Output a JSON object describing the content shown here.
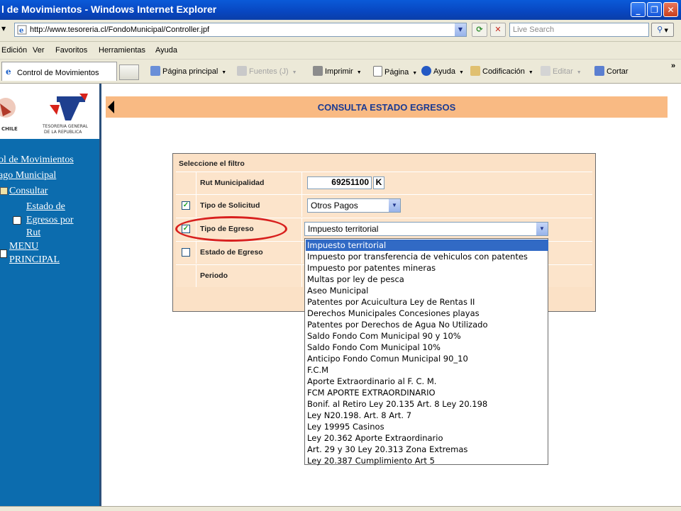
{
  "window": {
    "title": "l de Movimientos - Windows Internet Explorer",
    "controls": [
      "minimize",
      "maximize",
      "close"
    ]
  },
  "addressbar": {
    "url": "http://www.tesoreria.cl/FondoMunicipal/Controller.jpf",
    "search_placeholder": "Live Search"
  },
  "menubar": [
    "Edición",
    "Ver",
    "Favoritos",
    "Herramientas",
    "Ayuda"
  ],
  "tab": {
    "label": "Control de Movimientos"
  },
  "commandbar": {
    "home": "Página principal",
    "feeds": "Fuentes (J)",
    "print": "Imprimir",
    "page": "Página",
    "help": "Ayuda",
    "encoding": "Codificación",
    "edit": "Editar",
    "cut": "Cortar"
  },
  "logo": {
    "chile_text": "CHILE",
    "org_line1": "TESORERIA GENERAL",
    "org_line2": "DE LA REPUBLICA"
  },
  "sidebar": {
    "link1": "ol de Movimientos",
    "link2": "ago Municipal",
    "link3": "Consultar",
    "link4_l1": "Estado de",
    "link4_l2": "Egresos por",
    "link4_l3": "Rut",
    "link5_l1": "MENU",
    "link5_l2": "PRINCIPAL"
  },
  "header": {
    "title": "CONSULTA ESTADO EGRESOS"
  },
  "filter": {
    "title": "Seleccione el filtro",
    "rut_label": "Rut Municipalidad",
    "rut_value": "69251100",
    "rut_dv": "K",
    "tipo_solicitud_label": "Tipo de Solicitud",
    "tipo_solicitud_value": "Otros Pagos",
    "tipo_solicitud_checked": true,
    "tipo_egreso_label": "Tipo de Egreso",
    "tipo_egreso_value": "Impuesto territorial",
    "tipo_egreso_checked": true,
    "estado_egreso_label": "Estado de Egreso",
    "estado_egreso_checked": false,
    "periodo_label": "Periodo"
  },
  "egreso_options": [
    "Impuesto territorial",
    "Impuesto por transferencia de vehiculos con patentes",
    "Impuesto por patentes mineras",
    "Multas por ley de pesca",
    "Aseo Municipal",
    "Patentes por Acuicultura Ley de Rentas II",
    "Derechos Municipales Concesiones playas",
    "Patentes por Derechos de Agua No Utilizado",
    "Saldo Fondo Com Municipal 90 y 10%",
    "Saldo Fondo Com Municipal 10%",
    "Anticipo Fondo Comun Municipal 90_10",
    "F.C.M",
    "Aporte Extraordinario al F. C. M.",
    "FCM APORTE EXTRAORDINARIO",
    "Bonif. al Retiro Ley 20.135 Art. 8 Ley 20.198",
    "Ley N20.198. Art. 8 Art. 7",
    "Ley 19995 Casinos",
    "Ley 20.362 Aporte Extraordinario",
    "Art. 29 y 30 Ley 20.313 Zona Extremas",
    "Ley 20.387 Cumplimiento Art 5"
  ],
  "colors": {
    "sidebar": "#0c6cae",
    "header_bar": "#f9ba83",
    "panel": "#fbe1c6",
    "selection": "#316ac5",
    "highlight_circle": "#d8201e"
  }
}
